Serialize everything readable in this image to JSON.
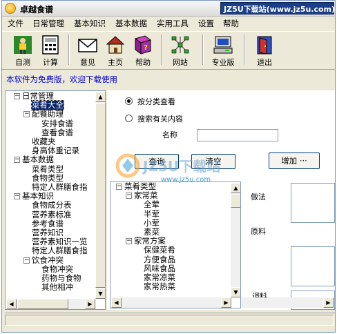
{
  "window": {
    "title": "卓越食谱"
  },
  "watermark": {
    "badge": "JZ5U下载站(www.jz5u.com)",
    "logo": "JZ5U下载站",
    "url": "www.jz5u.com"
  },
  "menu": [
    "文件",
    "日常管理",
    "基本知识",
    "基本数据",
    "实用工具",
    "设置",
    "帮助"
  ],
  "toolbar": {
    "buttons": [
      {
        "label": "自测",
        "icon": "person-icon"
      },
      {
        "label": "计算",
        "icon": "calculator-icon"
      },
      {
        "label": "意见",
        "icon": "envelope-icon"
      },
      {
        "label": "主页",
        "icon": "house-icon"
      },
      {
        "label": "帮助",
        "icon": "help-book-icon"
      },
      {
        "label": "网站",
        "icon": "network-icon"
      },
      {
        "label": "专业版",
        "icon": "computer-icon"
      },
      {
        "label": "退出",
        "icon": "exit-door-icon"
      }
    ]
  },
  "notice": "本软件为免费版，欢迎下载使用",
  "tree": {
    "items": [
      {
        "label": "日常管理",
        "level": 0,
        "box": "−"
      },
      {
        "label": "菜肴大全",
        "level": 1,
        "selected": true
      },
      {
        "label": "配餐助理",
        "level": 1,
        "box": "−"
      },
      {
        "label": "安排食谱",
        "level": 2
      },
      {
        "label": "查看食谱",
        "level": 2
      },
      {
        "label": "收藏夹",
        "level": 1
      },
      {
        "label": "身高体重记录",
        "level": 1
      },
      {
        "label": "基本数据",
        "level": 0,
        "box": "−"
      },
      {
        "label": "菜肴类型",
        "level": 1
      },
      {
        "label": "食物类型",
        "level": 1
      },
      {
        "label": "特定人群膳食指",
        "level": 1
      },
      {
        "label": "基本知识",
        "level": 0,
        "box": "−"
      },
      {
        "label": "食物成分表",
        "level": 1
      },
      {
        "label": "营养素标准",
        "level": 1
      },
      {
        "label": "参考食谱",
        "level": 1
      },
      {
        "label": "营养知识",
        "level": 1
      },
      {
        "label": "营养素知识一览",
        "level": 1
      },
      {
        "label": "特定人群膳食指",
        "level": 1
      },
      {
        "label": "饮食冲突",
        "level": 1,
        "box": "−"
      },
      {
        "label": "食物冲突",
        "level": 2
      },
      {
        "label": "药物与食物",
        "level": 2
      },
      {
        "label": "其他相冲",
        "level": 2
      }
    ]
  },
  "main": {
    "radio_category": "按分类查看",
    "radio_search": "搜索有关内容",
    "name_label": "名称",
    "name_value": "",
    "query_button": "查询",
    "clear_button": "清空",
    "add_button": "增加 ···",
    "method_label": "做法",
    "ingredients_label": "原料",
    "seasoning_label": "调料"
  },
  "subtree": {
    "items": [
      {
        "label": "菜肴类型",
        "level": 0,
        "box": "−"
      },
      {
        "label": "家常菜",
        "level": 1,
        "box": "−"
      },
      {
        "label": "全荤",
        "level": 2
      },
      {
        "label": "半荤",
        "level": 2
      },
      {
        "label": "小荤",
        "level": 2
      },
      {
        "label": "素菜",
        "level": 2
      },
      {
        "label": "家常方案",
        "level": 1,
        "box": "−"
      },
      {
        "label": "保健菜肴",
        "level": 2
      },
      {
        "label": "方便食品",
        "level": 2
      },
      {
        "label": "风味食品",
        "level": 2
      },
      {
        "label": "家常凉菜",
        "level": 2
      },
      {
        "label": "家常热菜",
        "level": 2
      }
    ]
  },
  "colors": {
    "selection": "#0a246a",
    "notice": "#0000cc",
    "badge": "#1a3f88"
  }
}
